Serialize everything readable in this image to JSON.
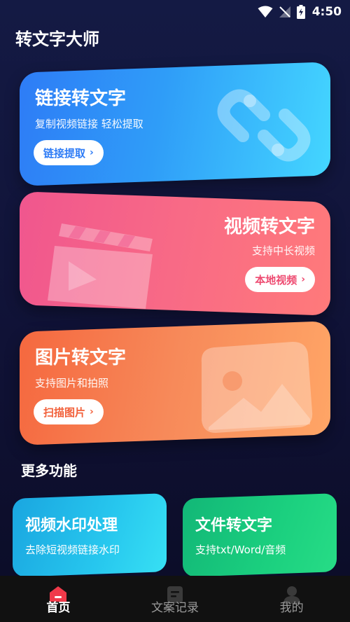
{
  "status_bar": {
    "time": "4:50"
  },
  "app": {
    "title": "转文字大师"
  },
  "cards": {
    "link": {
      "title": "链接转文字",
      "subtitle": "复制视频链接 轻松提取",
      "button": "链接提取"
    },
    "video": {
      "title": "视频转文字",
      "subtitle": "支持中长视频",
      "button": "本地视频"
    },
    "image": {
      "title": "图片转文字",
      "subtitle": "支持图片和拍照",
      "button": "扫描图片"
    }
  },
  "more": {
    "title": "更多功能",
    "items": [
      {
        "title": "视频水印处理",
        "subtitle": "去除短视频链接水印"
      },
      {
        "title": "文件转文字",
        "subtitle": "支持txt/Word/音频"
      }
    ]
  },
  "nav": {
    "items": [
      {
        "label": "首页",
        "icon": "home-icon",
        "active": true
      },
      {
        "label": "文案记录",
        "icon": "document-icon",
        "active": false
      },
      {
        "label": "我的",
        "icon": "profile-icon",
        "active": false
      }
    ]
  },
  "colors": {
    "background": "#141a44",
    "link_card": "#2f9df8",
    "video_card": "#f86a86",
    "image_card": "#f78a5a",
    "watermark_card": "#27c7ee",
    "file_card": "#1bd07f",
    "nav_active": "#f03a4a"
  }
}
